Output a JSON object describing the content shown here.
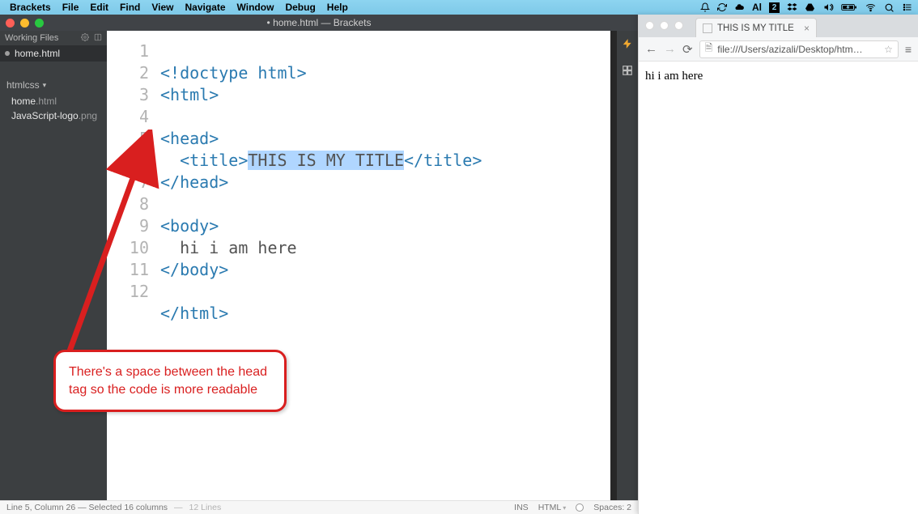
{
  "menubar": {
    "app": "Brackets",
    "items": [
      "File",
      "Edit",
      "Find",
      "View",
      "Navigate",
      "Window",
      "Debug",
      "Help"
    ],
    "tray": {
      "al": "Al",
      "two": "2"
    }
  },
  "brackets": {
    "title": "• home.html — Brackets",
    "sidebar": {
      "working_files_label": "Working Files",
      "working_file": "home.html",
      "project_name": "htmlcss",
      "files": [
        {
          "name": "home",
          "ext": ".html"
        },
        {
          "name": "JavaScript-logo",
          "ext": ".png"
        }
      ]
    },
    "line_numbers": [
      "1",
      "2",
      "3",
      "4",
      "5",
      "6",
      "7",
      "8",
      "9",
      "10",
      "11",
      "12"
    ],
    "code": {
      "l1_a": "<!doctype html>",
      "l2_a": "<html>",
      "l4_a": "<head>",
      "l5_indent": "  ",
      "l5_open": "<title>",
      "l5_text": "THIS IS MY TITLE",
      "l5_close": "</title>",
      "l6_a": "</head>",
      "l8_a": "<body>",
      "l9_indent": "  ",
      "l9_text": "hi i am here",
      "l10_a": "</body>",
      "l12_a": "</html>"
    },
    "statusbar": {
      "cursor": "Line 5, Column 26 — Selected 16 columns",
      "lines": "12 Lines",
      "ins": "INS",
      "lang": "HTML",
      "spaces": "Spaces: 2"
    }
  },
  "callout": {
    "text": "There's a space between the head tag so the code is more readable"
  },
  "chrome": {
    "tab_title": "THIS IS MY TITLE",
    "url": "file:///Users/azizali/Desktop/htm…",
    "page_text": "hi i am here"
  }
}
